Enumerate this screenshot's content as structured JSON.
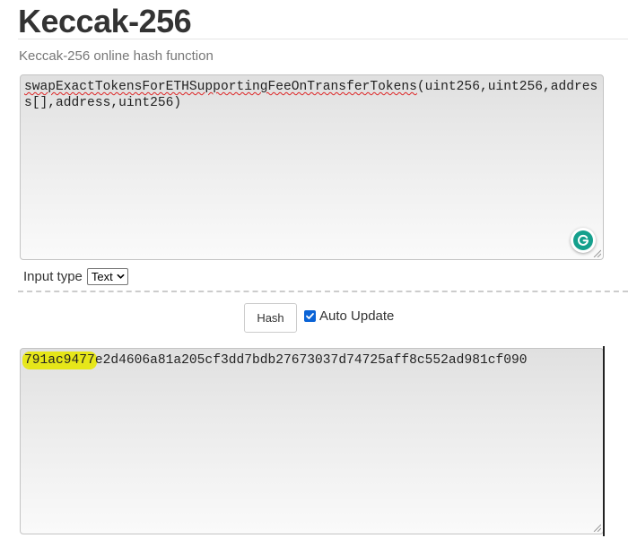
{
  "page": {
    "title": "Keccak-256",
    "subtitle": "Keccak-256 online hash function"
  },
  "input": {
    "function_name": "swapExactTokensForETHSupportingFeeOnTransferTokens",
    "arguments": "(uint256,uint256,address[],address,uint256)"
  },
  "options": {
    "input_type_label": "Input type",
    "input_type_value": "Text",
    "hash_button_label": "Hash",
    "auto_update_label": "Auto Update",
    "auto_update_checked": true
  },
  "output": {
    "hash_highlighted": "791ac9477",
    "hash_rest": "e2d4606a81a205cf3dd7bdb27673037d74725aff8c552ad981cf090"
  },
  "colors": {
    "highlight": "#e6e619",
    "grammarly": "#15a08d",
    "checkbox": "#0a63d6",
    "spellcheck_underline": "#dd2222"
  },
  "icons": {
    "grammarly": "grammarly-g-icon",
    "select_arrow": "chevron-down-icon",
    "checkbox": "checkmark-icon",
    "resize": "resize-handle-icon"
  }
}
